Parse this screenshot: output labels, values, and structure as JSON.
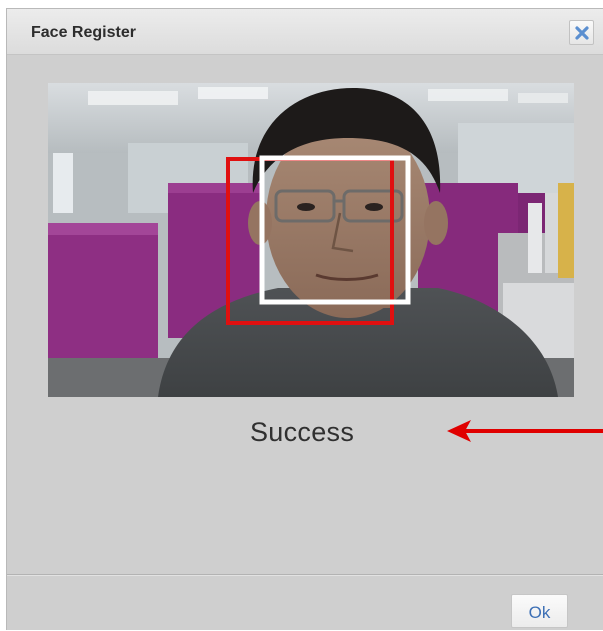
{
  "dialog": {
    "title": "Face Register",
    "close_icon": "close-x-icon",
    "camera_preview": {
      "content": "camera-photo-with-face",
      "detection_box_color": "#e01010",
      "alignment_box_color": "#ffffff"
    },
    "status_text": "Success",
    "annotation_arrow_color": "#e00000",
    "ok_label": "Ok"
  },
  "colors": {
    "dialog_background": "#cfcfcf",
    "titlebar": "#e2e2e2",
    "ok_text": "#3c6fb5",
    "close_icon": "#5b8fd0"
  }
}
